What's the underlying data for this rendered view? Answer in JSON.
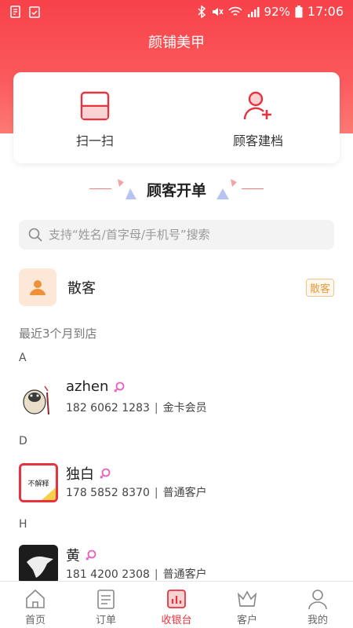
{
  "status_bar": {
    "battery": "92%",
    "time": "17:06"
  },
  "app": {
    "title": "颜铺美甲"
  },
  "actions": [
    {
      "label": "扫一扫",
      "icon": "scan-icon"
    },
    {
      "label": "顾客建档",
      "icon": "add-user-icon"
    }
  ],
  "section": {
    "title": "顾客开单"
  },
  "search": {
    "placeholder": "支持“姓名/首字母/手机号”搜索"
  },
  "walkin": {
    "name": "散客",
    "badge": "散客"
  },
  "recent_label": "最近3个月到店",
  "groups": [
    {
      "letter": "A",
      "customer": {
        "name": "azhen",
        "phone": "182 6062 1283",
        "level": "金卡会员",
        "gender": "female"
      }
    },
    {
      "letter": "D",
      "customer": {
        "name": "独白",
        "phone": "178 5852 8370",
        "level": "普通客户",
        "gender": "female"
      }
    },
    {
      "letter": "H",
      "customer": {
        "name": "黄",
        "phone": "181 4200 2308",
        "level": "普通客户",
        "gender": "female"
      }
    }
  ],
  "avatar_text": {
    "dubai": "不解释"
  },
  "tabs": [
    {
      "label": "首页",
      "icon": "home-icon",
      "active": false
    },
    {
      "label": "订单",
      "icon": "order-icon",
      "active": false
    },
    {
      "label": "收银台",
      "icon": "cashier-icon",
      "active": true
    },
    {
      "label": "客户",
      "icon": "crown-icon",
      "active": false
    },
    {
      "label": "我的",
      "icon": "profile-icon",
      "active": false
    }
  ],
  "colors": {
    "brand_red": "#f7424a",
    "active_tab": "#e8333f",
    "female_pink": "#e85fc0",
    "walkin_orange": "#f0913a"
  }
}
